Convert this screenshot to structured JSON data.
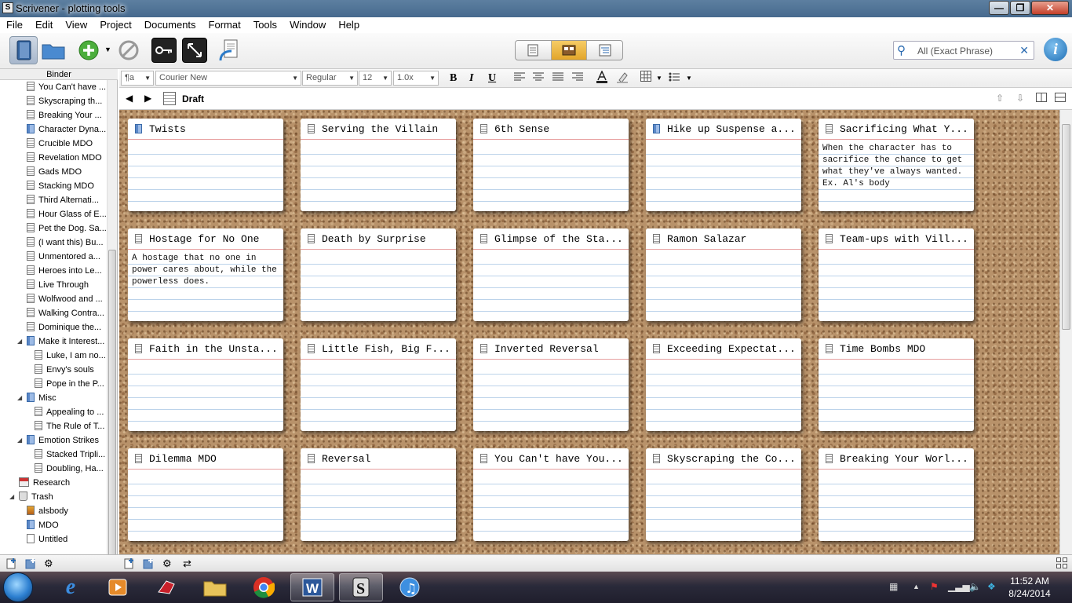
{
  "window": {
    "title": "Scrivener - plotting tools",
    "minimize": "—",
    "maximize": "❐",
    "close": "✕"
  },
  "menu": [
    "File",
    "Edit",
    "View",
    "Project",
    "Documents",
    "Format",
    "Tools",
    "Window",
    "Help"
  ],
  "toolbar": {
    "search_placeholder": "All (Exact Phrase)",
    "info": "i"
  },
  "binder": {
    "header": "Binder",
    "items": [
      {
        "label": "You Can't have ...",
        "icon": "document-icon",
        "indent": 1
      },
      {
        "label": "Skyscraping th...",
        "icon": "document-icon",
        "indent": 1
      },
      {
        "label": "Breaking Your ...",
        "icon": "document-icon",
        "indent": 1
      },
      {
        "label": "Character Dyna...",
        "icon": "folder-icon",
        "indent": 1
      },
      {
        "label": "Crucible MDO",
        "icon": "document-icon",
        "indent": 1
      },
      {
        "label": "Revelation MDO",
        "icon": "document-icon",
        "indent": 1
      },
      {
        "label": "Gads MDO",
        "icon": "document-icon",
        "indent": 1
      },
      {
        "label": "Stacking MDO",
        "icon": "document-icon",
        "indent": 1
      },
      {
        "label": "Third Alternati...",
        "icon": "document-icon",
        "indent": 1
      },
      {
        "label": "Hour Glass of E...",
        "icon": "document-icon",
        "indent": 1
      },
      {
        "label": "Pet the Dog. Sa...",
        "icon": "document-icon",
        "indent": 1
      },
      {
        "label": "(I want this) Bu...",
        "icon": "document-icon",
        "indent": 1
      },
      {
        "label": "Unmentored a...",
        "icon": "document-icon",
        "indent": 1
      },
      {
        "label": "Heroes into Le...",
        "icon": "document-icon",
        "indent": 1
      },
      {
        "label": "Live Through",
        "icon": "document-icon",
        "indent": 1
      },
      {
        "label": "Wolfwood and ...",
        "icon": "document-icon",
        "indent": 1
      },
      {
        "label": "Walking Contra...",
        "icon": "document-icon",
        "indent": 1
      },
      {
        "label": "Dominique the...",
        "icon": "document-icon",
        "indent": 1
      },
      {
        "label": "Make it Interest...",
        "icon": "folder-icon",
        "indent": 1,
        "expanded": true
      },
      {
        "label": "Luke, I am no...",
        "icon": "document-icon",
        "indent": 2
      },
      {
        "label": "Envy's souls",
        "icon": "document-icon",
        "indent": 2
      },
      {
        "label": "Pope in the P...",
        "icon": "document-icon",
        "indent": 2
      },
      {
        "label": "Misc",
        "icon": "folder-icon",
        "indent": 1,
        "expanded": true
      },
      {
        "label": "Appealing to ...",
        "icon": "document-icon",
        "indent": 2
      },
      {
        "label": "The Rule of T...",
        "icon": "document-icon",
        "indent": 2
      },
      {
        "label": "Emotion Strikes",
        "icon": "folder-icon",
        "indent": 1,
        "expanded": true
      },
      {
        "label": "Stacked Tripli...",
        "icon": "document-icon",
        "indent": 2
      },
      {
        "label": "Doubling, Ha...",
        "icon": "document-icon",
        "indent": 2
      },
      {
        "label": "Research",
        "icon": "research-icon",
        "indent": 0
      },
      {
        "label": "Trash",
        "icon": "trash-icon",
        "indent": 0,
        "expanded": true
      },
      {
        "label": "alsbody",
        "icon": "image-icon",
        "indent": 1
      },
      {
        "label": "MDO",
        "icon": "folder-icon",
        "indent": 1
      },
      {
        "label": "Untitled",
        "icon": "blank-document-icon",
        "indent": 1
      }
    ]
  },
  "format": {
    "style": "¶a",
    "font": "Courier New",
    "weight": "Regular",
    "size": "12",
    "spacing": "1.0x",
    "bold": "B",
    "italic": "I",
    "underline": "U"
  },
  "header": {
    "title": "Draft",
    "back": "◀",
    "forward": "▶"
  },
  "cards": [
    {
      "title": "Twists",
      "icon": "folder-icon",
      "synopsis": ""
    },
    {
      "title": "Serving the Villain",
      "icon": "document-icon",
      "synopsis": ""
    },
    {
      "title": "6th Sense",
      "icon": "document-icon",
      "synopsis": ""
    },
    {
      "title": "Hike up Suspense a...",
      "icon": "folder-icon",
      "synopsis": ""
    },
    {
      "title": "Sacrificing What Y...",
      "icon": "document-icon",
      "synopsis": "When the character has to sacrifice the chance to get what they've always wanted. Ex. Al's body"
    },
    {
      "title": "Hostage for No One",
      "icon": "document-icon",
      "synopsis": "A hostage that no one in power cares about, while the powerless does."
    },
    {
      "title": "Death by Surprise",
      "icon": "document-icon",
      "synopsis": ""
    },
    {
      "title": "Glimpse of the Sta...",
      "icon": "document-icon",
      "synopsis": ""
    },
    {
      "title": "Ramon Salazar",
      "icon": "document-icon",
      "synopsis": ""
    },
    {
      "title": "Team-ups with Vill...",
      "icon": "document-icon",
      "synopsis": ""
    },
    {
      "title": "Faith in the Unsta...",
      "icon": "document-icon",
      "synopsis": ""
    },
    {
      "title": "Little Fish, Big F...",
      "icon": "document-icon",
      "synopsis": ""
    },
    {
      "title": "Inverted Reversal",
      "icon": "document-icon",
      "synopsis": ""
    },
    {
      "title": "Exceeding Expectat...",
      "icon": "document-icon",
      "synopsis": ""
    },
    {
      "title": "Time Bombs MDO",
      "icon": "document-icon",
      "synopsis": ""
    },
    {
      "title": "Dilemma MDO",
      "icon": "document-icon",
      "synopsis": ""
    },
    {
      "title": "Reversal",
      "icon": "document-icon",
      "synopsis": ""
    },
    {
      "title": "You Can't have You...",
      "icon": "document-icon",
      "synopsis": ""
    },
    {
      "title": "Skyscraping the Co...",
      "icon": "document-icon",
      "synopsis": ""
    },
    {
      "title": "Breaking Your Worl...",
      "icon": "document-icon",
      "synopsis": ""
    }
  ],
  "taskbar": {
    "time": "11:52 AM",
    "date": "8/24/2014"
  }
}
